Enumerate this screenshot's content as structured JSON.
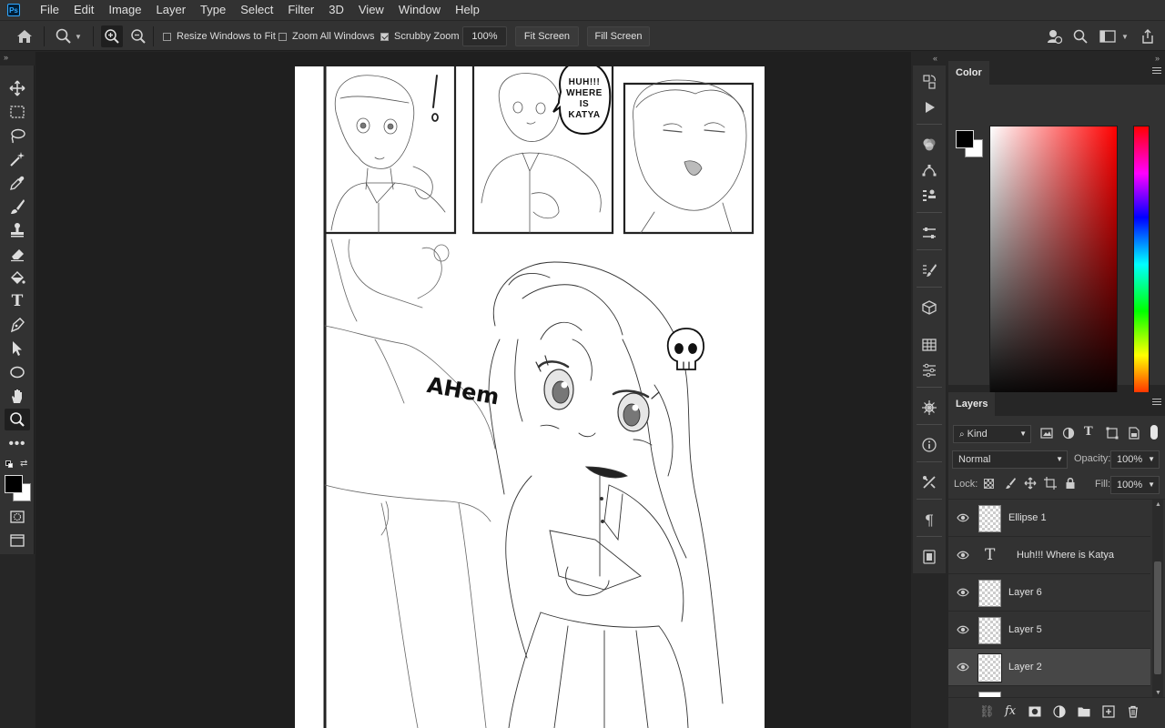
{
  "app": {
    "logo": "Ps"
  },
  "menubar": {
    "items": [
      "File",
      "Edit",
      "Image",
      "Layer",
      "Type",
      "Select",
      "Filter",
      "3D",
      "View",
      "Window",
      "Help"
    ]
  },
  "options": {
    "resize_windows": {
      "label": "Resize Windows to Fit",
      "checked": false
    },
    "zoom_all": {
      "label": "Zoom All Windows",
      "checked": false
    },
    "scrubby_zoom": {
      "label": "Scrubby Zoom",
      "checked": true
    },
    "zoom_value": "100%",
    "fit_screen": "Fit Screen",
    "fill_screen": "Fill Screen"
  },
  "panels": {
    "color": {
      "tab": "Color",
      "foreground": "#000000",
      "background": "#ffffff"
    },
    "layers": {
      "tab": "Layers",
      "filter_kind": "Kind",
      "blend_mode": "Normal",
      "opacity_label": "Opacity:",
      "opacity_value": "100%",
      "lock_label": "Lock:",
      "fill_label": "Fill:",
      "fill_value": "100%",
      "items": [
        {
          "name": "Ellipse 1",
          "type": "pixel",
          "selected": false
        },
        {
          "name": "Huh!!! Where   is Katya",
          "type": "text",
          "selected": false
        },
        {
          "name": "Layer 6",
          "type": "pixel",
          "selected": false
        },
        {
          "name": "Layer 5",
          "type": "pixel",
          "selected": false
        },
        {
          "name": "Layer 2",
          "type": "pixel",
          "selected": true
        }
      ]
    }
  },
  "artwork": {
    "speech_bubble": [
      "HUH!!!",
      "WHERE",
      "IS",
      "KATYA"
    ],
    "sfx": "AHem",
    "exclamation": "!"
  }
}
